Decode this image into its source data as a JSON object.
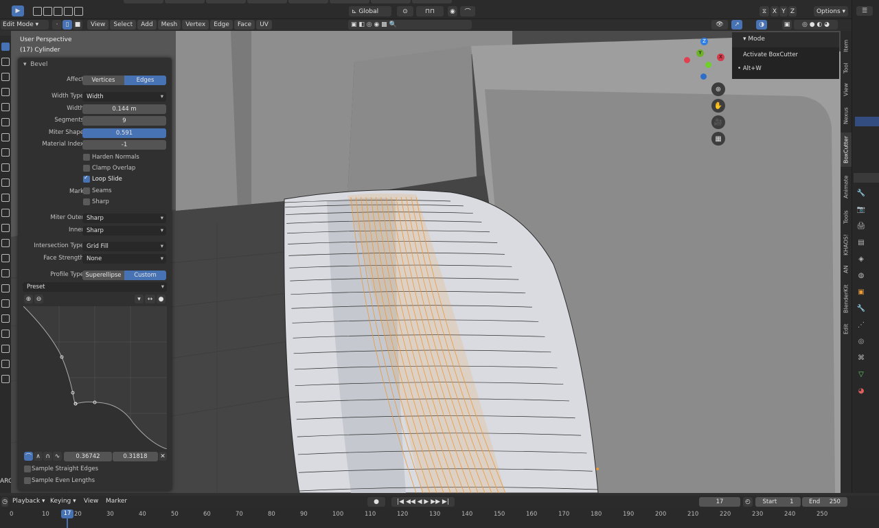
{
  "top_bar": {
    "transform_orientation": "Global",
    "axes": [
      "X",
      "Y",
      "Z"
    ],
    "options_label": "Options"
  },
  "header": {
    "mode": "Edit Mode",
    "menus": [
      "View",
      "Select",
      "Add",
      "Mesh",
      "Vertex",
      "Edge",
      "Face",
      "UV"
    ]
  },
  "viewport": {
    "perspective": "User Perspective",
    "object": "(17) Cylinder",
    "gizmo_axes": [
      "X",
      "Y",
      "Z"
    ]
  },
  "bevel": {
    "title": "Bevel",
    "affect_label": "Affect",
    "affect_options": [
      "Vertices",
      "Edges"
    ],
    "affect_selected": "Edges",
    "width_type_label": "Width Type",
    "width_type": "Width",
    "width_label": "Width",
    "width": "0.144 m",
    "segments_label": "Segments",
    "segments": "9",
    "miter_shape_label": "Miter Shape",
    "miter_shape": "0.591",
    "material_index_label": "Material Index",
    "material_index": "-1",
    "harden_normals": "Harden Normals",
    "clamp_overlap": "Clamp Overlap",
    "loop_slide": "Loop Slide",
    "mark_label": "Mark",
    "seams": "Seams",
    "sharp": "Sharp",
    "miter_outer_label": "Miter Outer",
    "miter_outer": "Sharp",
    "inner_label": "Inner",
    "inner": "Sharp",
    "intersection_type_label": "Intersection Type",
    "intersection_type": "Grid Fill",
    "face_strength_label": "Face Strength",
    "face_strength": "None",
    "profile_type_label": "Profile Type",
    "profile_options": [
      "Superellipse",
      "Custom"
    ],
    "profile_selected": "Custom",
    "preset": "Preset",
    "curve_x": "0.36742",
    "curve_y": "0.31818",
    "sample_straight": "Sample Straight Edges",
    "sample_even": "Sample Even Lengths"
  },
  "popup": {
    "title": "Mode",
    "item": "Activate BoxCutter",
    "shortcut": "• Alt+W"
  },
  "sidebar_tabs": [
    "Item",
    "Tool",
    "View",
    "Nexus",
    "BoxCutter",
    "Animate",
    "Tools",
    "KHAOS!",
    "AN",
    "BlenderKit",
    "Edit"
  ],
  "search_fragment": "ARCH",
  "timeline": {
    "menus": [
      "Playback",
      "Keying",
      "View",
      "Marker"
    ],
    "current_frame": "17",
    "start_label": "Start",
    "start": "1",
    "end_label": "End",
    "end": "250",
    "ticks": [
      "0",
      "10",
      "20",
      "30",
      "40",
      "50",
      "60",
      "70",
      "80",
      "90",
      "100",
      "110",
      "120",
      "130",
      "140",
      "150",
      "160",
      "170",
      "180",
      "190",
      "200",
      "210",
      "220",
      "230",
      "240",
      "250"
    ],
    "playhead": "17"
  }
}
